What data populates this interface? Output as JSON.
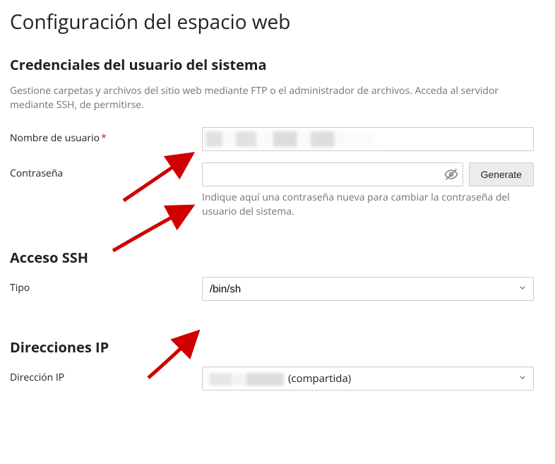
{
  "page": {
    "title": "Configuración del espacio web"
  },
  "credentials": {
    "heading": "Credenciales del usuario del sistema",
    "description": "Gestione carpetas y archivos del sitio web mediante FTP o el administrador de archivos. Acceda al servidor mediante SSH, de permitirse.",
    "username_label": "Nombre de usuario",
    "username_value": "",
    "password_label": "Contraseña",
    "password_value": "",
    "password_hint": "Indique aquí una contraseña nueva para cambiar la contraseña del usuario del sistema.",
    "generate_label": "Generate"
  },
  "ssh": {
    "heading": "Acceso SSH",
    "type_label": "Tipo",
    "type_value": "/bin/sh"
  },
  "ip": {
    "heading": "Direcciones IP",
    "ip_label": "Dirección IP",
    "ip_suffix": "(compartida)"
  }
}
